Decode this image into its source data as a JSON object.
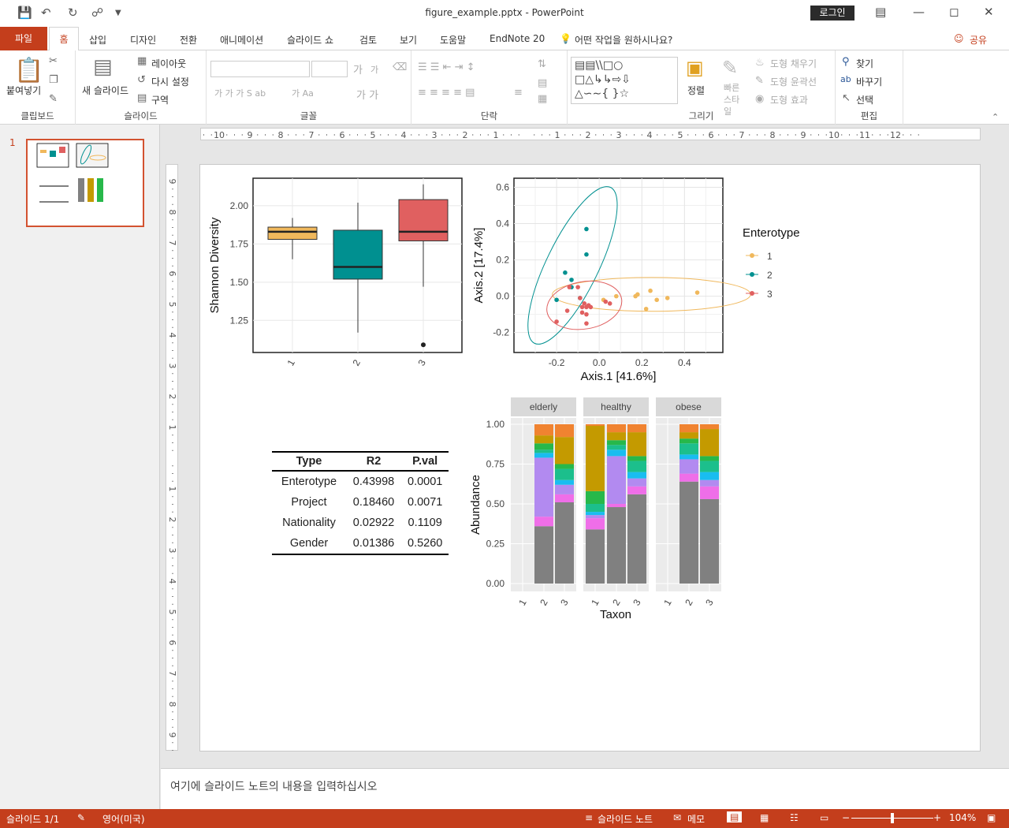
{
  "window": {
    "title": "figure_example.pptx  -  PowerPoint",
    "login": "로그인"
  },
  "tabs": [
    "파일",
    "홈",
    "삽입",
    "디자인",
    "전환",
    "애니메이션",
    "슬라이드 쇼",
    "검토",
    "보기",
    "도움말",
    "EndNote 20",
    "어떤 작업을 원하시나요?",
    "공유"
  ],
  "ribbon": {
    "clipboard": {
      "label": "클립보드",
      "paste": "붙여넣기"
    },
    "slides": {
      "label": "슬라이드",
      "new_slide": "새 슬라이드",
      "layout": "레이아웃",
      "reset": "다시 설정",
      "section": "구역"
    },
    "font": {
      "label": "글꼴"
    },
    "paragraph": {
      "label": "단락"
    },
    "drawing": {
      "label": "그리기",
      "arrange": "정렬",
      "quick_styles": "빠른 스타일",
      "fill": "도형 채우기",
      "outline": "도형 윤곽선",
      "effects": "도형 효과"
    },
    "editing": {
      "label": "편집",
      "find": "찾기",
      "replace": "바꾸기",
      "select": "선택"
    }
  },
  "thumbnail": {
    "number": "1"
  },
  "notes_placeholder": "여기에 슬라이드 노트의 내용을 입력하십시오",
  "status": {
    "slide": "슬라이드 1/1",
    "language": "영어(미국)",
    "notes": "슬라이드 노트",
    "comments": "메모",
    "zoom": "104%"
  },
  "colors": {
    "accent": "#c43e1c",
    "e1": "#f0b85c",
    "e2": "#009090",
    "e3": "#e06060"
  },
  "chart_data": [
    {
      "type": "box",
      "categories": [
        "1",
        "2",
        "3"
      ],
      "ylabel": "Shannon Diversity",
      "yticks": [
        "1.25",
        "1.50",
        "1.75",
        "2.00"
      ],
      "boxes": [
        {
          "min": 1.65,
          "q1": 1.78,
          "median": 1.83,
          "q3": 1.86,
          "max": 1.92
        },
        {
          "min": 1.17,
          "q1": 1.52,
          "median": 1.6,
          "q3": 1.84,
          "max": 2.02,
          "outliers": []
        },
        {
          "min": 1.47,
          "q1": 1.77,
          "median": 1.83,
          "q3": 2.04,
          "max": 2.14,
          "outliers": [
            1.09
          ]
        }
      ]
    },
    {
      "type": "scatter",
      "xlabel": "Axis.1   [41.6%]",
      "ylabel": "Axis.2   [17.4%]",
      "xticks": [
        "-0.2",
        "0.0",
        "0.2",
        "0.4"
      ],
      "yticks": [
        "-0.2",
        "0.0",
        "0.2",
        "0.4",
        "0.6"
      ],
      "legend": {
        "title": "Enterotype",
        "entries": [
          "1",
          "2",
          "3"
        ]
      },
      "series": [
        {
          "name": "1",
          "points": [
            [
              0.02,
              -0.02
            ],
            [
              0.08,
              0.0
            ],
            [
              0.17,
              0.0
            ],
            [
              0.18,
              0.01
            ],
            [
              0.24,
              0.03
            ],
            [
              0.22,
              -0.07
            ],
            [
              0.27,
              -0.02
            ],
            [
              0.32,
              -0.01
            ],
            [
              0.46,
              0.02
            ]
          ]
        },
        {
          "name": "2",
          "points": [
            [
              -0.06,
              0.37
            ],
            [
              -0.06,
              0.23
            ],
            [
              -0.16,
              0.13
            ],
            [
              -0.13,
              0.09
            ],
            [
              -0.2,
              -0.02
            ],
            [
              -0.13,
              0.05
            ],
            [
              -0.09,
              -0.01
            ]
          ]
        },
        {
          "name": "3",
          "points": [
            [
              -0.2,
              -0.14
            ],
            [
              -0.15,
              -0.08
            ],
            [
              -0.14,
              0.05
            ],
            [
              -0.1,
              0.05
            ],
            [
              -0.09,
              -0.01
            ],
            [
              -0.08,
              -0.06
            ],
            [
              -0.07,
              -0.04
            ],
            [
              -0.06,
              -0.06
            ],
            [
              -0.05,
              -0.05
            ],
            [
              -0.04,
              -0.06
            ],
            [
              -0.08,
              -0.09
            ],
            [
              -0.06,
              -0.1
            ],
            [
              -0.06,
              -0.15
            ],
            [
              0.03,
              -0.03
            ],
            [
              0.05,
              -0.04
            ]
          ]
        }
      ]
    },
    {
      "type": "stacked-bar",
      "xlabel": "Taxon",
      "ylabel": "Abundance",
      "yticks": [
        "0.00",
        "0.25",
        "0.50",
        "0.75",
        "1.00"
      ],
      "panels": [
        {
          "name": "elderly",
          "bars": [
            null,
            {
              "x": "2",
              "segments": [
                0.36,
                0.06,
                0.37,
                0.03,
                0.02,
                0.04,
                0.05,
                0.07
              ]
            },
            {
              "x": "3",
              "segments": [
                0.51,
                0.05,
                0.06,
                0.03,
                0.07,
                0.03,
                0.17,
                0.08
              ]
            }
          ]
        },
        {
          "name": "healthy",
          "bars": [
            {
              "x": "1",
              "segments": [
                0.34,
                0.07,
                0.02,
                0.02,
                0.05,
                0.08,
                0.41,
                0.01
              ]
            },
            {
              "x": "2",
              "segments": [
                0.48,
                0.02,
                0.3,
                0.04,
                0.03,
                0.03,
                0.05,
                0.05
              ]
            },
            {
              "x": "3",
              "segments": [
                0.56,
                0.05,
                0.05,
                0.04,
                0.07,
                0.03,
                0.15,
                0.05
              ]
            }
          ]
        },
        {
          "name": "obese",
          "bars": [
            null,
            {
              "x": "2",
              "segments": [
                0.64,
                0.05,
                0.09,
                0.03,
                0.07,
                0.03,
                0.04,
                0.05
              ]
            },
            {
              "x": "3",
              "segments": [
                0.53,
                0.08,
                0.04,
                0.05,
                0.07,
                0.03,
                0.17,
                0.03
              ]
            }
          ]
        }
      ],
      "segment_colors": [
        "#808080",
        "#ef6ee8",
        "#b28af0",
        "#19bdf0",
        "#1cbf8c",
        "#27b84a",
        "#c49a00",
        "#f08330"
      ],
      "categories": [
        "1",
        "2",
        "3"
      ]
    },
    {
      "type": "table",
      "headers": [
        "Type",
        "R2",
        "P.val"
      ],
      "rows": [
        [
          "Enterotype",
          "0.43998",
          "0.0001"
        ],
        [
          "Project",
          "0.18460",
          "0.0071"
        ],
        [
          "Nationality",
          "0.02922",
          "0.1109"
        ],
        [
          "Gender",
          "0.01386",
          "0.5260"
        ]
      ]
    }
  ]
}
